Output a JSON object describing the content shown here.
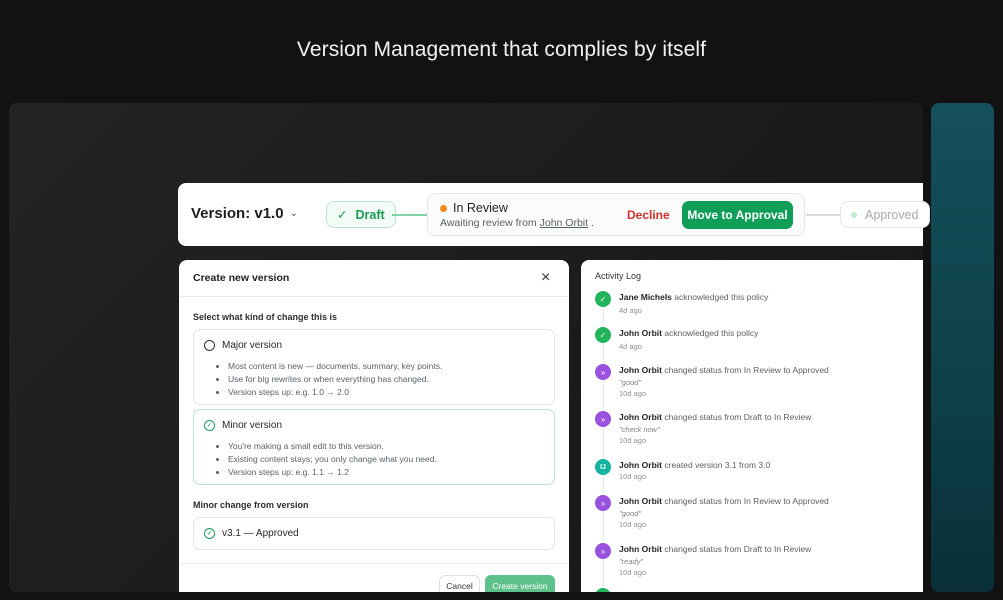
{
  "hero": {
    "title": "Version Management that complies by itself"
  },
  "status_bar": {
    "version_label": "Version: v1.0",
    "steps": {
      "draft": "Draft",
      "in_review": "In Review",
      "approved": "Approved"
    },
    "review": {
      "subtitle_prefix": "Awaiting review from",
      "reviewer": "John Orbit",
      "subtitle_suffix": "."
    },
    "decline_label": "Decline",
    "approve_label": "Move to Approval"
  },
  "modal": {
    "title": "Create new version",
    "prompt": "Select what kind of change this is",
    "options": [
      {
        "label": "Major version",
        "selected": false,
        "bullets": [
          "Most content is new — documents, summary, key points.",
          "Use for big rewrites or when everything has changed.",
          "Version steps up: e.g. 1.0 → 2.0"
        ]
      },
      {
        "label": "Minor version",
        "selected": true,
        "bullets": [
          "You're making a small edit to this version.",
          "Existing content stays; you only change what you need.",
          "Version steps up: e.g. 1.1 → 1.2"
        ]
      }
    ],
    "from_label": "Minor change from version",
    "from_value": "v3.1 — Approved",
    "cancel_label": "Cancel",
    "create_label": "Create version"
  },
  "activity": {
    "title": "Activity Log",
    "items": [
      {
        "type": "ack",
        "actor": "Jane Michels",
        "action": "acknowledged this policy",
        "quote": "",
        "time": "4d ago"
      },
      {
        "type": "ack",
        "actor": "John Orbit",
        "action": "acknowledged this policy",
        "quote": "",
        "time": "4d ago"
      },
      {
        "type": "status",
        "actor": "John Orbit",
        "action": "changed status from In Review to Approved",
        "quote": "\"good\"",
        "time": "10d ago"
      },
      {
        "type": "status",
        "actor": "John Orbit",
        "action": "changed status from Draft to In Review",
        "quote": "\"check now\"",
        "time": "10d ago"
      },
      {
        "type": "user",
        "initials": "IJ",
        "actor": "John Orbit",
        "action": "created version 3.1 from 3.0",
        "quote": "",
        "time": "10d ago"
      },
      {
        "type": "status",
        "actor": "John Orbit",
        "action": "changed status from In Review to Approved",
        "quote": "\"good\"",
        "time": "10d ago"
      },
      {
        "type": "status",
        "actor": "John Orbit",
        "action": "changed status from Draft to In Review",
        "quote": "\"ready\"",
        "time": "10d ago"
      }
    ]
  },
  "colors": {
    "accent_green": "#0f9d58",
    "decline_red": "#d0312d",
    "review_orange": "#f08a1c",
    "status_purple": "#9b51e0"
  }
}
